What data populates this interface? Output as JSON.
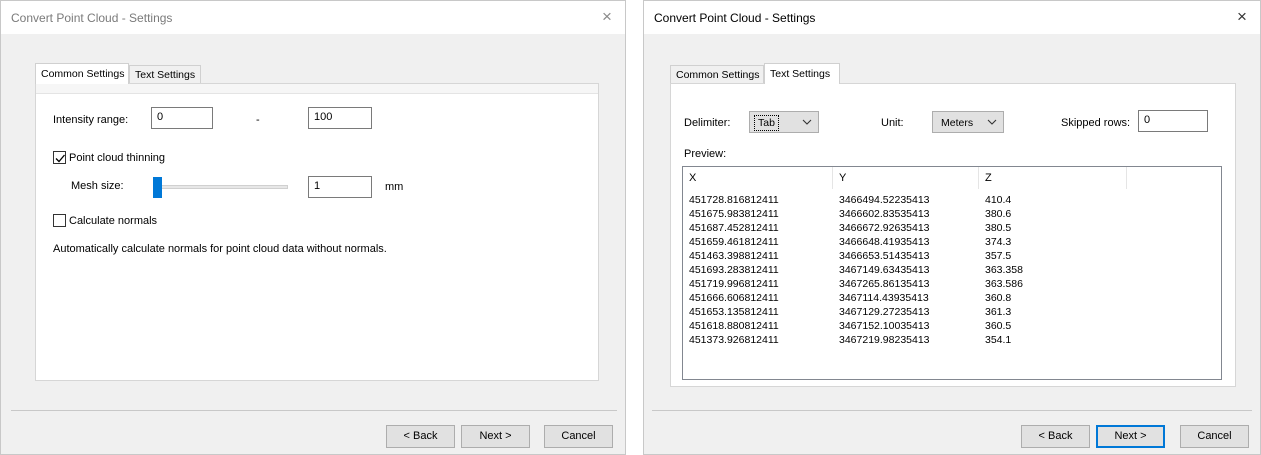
{
  "left_dialog": {
    "title": "Convert Point Cloud - Settings",
    "close_glyph": "×",
    "tabs": [
      {
        "label": "Common Settings",
        "active": true
      },
      {
        "label": "Text Settings",
        "active": false
      }
    ],
    "intensity_label": "Intensity range:",
    "intensity_min": "0",
    "intensity_dash": "-",
    "intensity_max": "100",
    "thinning_label": "Point cloud thinning",
    "thinning_checked": true,
    "mesh_label": "Mesh size:",
    "mesh_slider_value": 0,
    "mesh_value": "1",
    "mesh_unit": "mm",
    "normals_label": "Calculate normals",
    "normals_checked": false,
    "normals_description": "Automatically calculate normals for point cloud data without normals.",
    "buttons": {
      "back": "< Back",
      "next": "Next >",
      "cancel": "Cancel"
    }
  },
  "right_dialog": {
    "title": "Convert Point Cloud - Settings",
    "close_glyph": "×",
    "tabs": [
      {
        "label": "Common Settings",
        "active": false
      },
      {
        "label": "Text Settings",
        "active": true
      }
    ],
    "delimiter_label": "Delimiter:",
    "delimiter_value": "Tab",
    "unit_label": "Unit:",
    "unit_value": "Meters",
    "skipped_label": "Skipped rows:",
    "skipped_value": "0",
    "preview_label": "Preview:",
    "columns": [
      "X",
      "Y",
      "Z"
    ],
    "rows": [
      [
        "451728.816812411",
        "3466494.52235413",
        "410.4"
      ],
      [
        "451675.983812411",
        "3466602.83535413",
        "380.6"
      ],
      [
        "451687.452812411",
        "3466672.92635413",
        "380.5"
      ],
      [
        "451659.461812411",
        "3466648.41935413",
        "374.3"
      ],
      [
        "451463.398812411",
        "3466653.51435413",
        "357.5"
      ],
      [
        "451693.283812411",
        "3467149.63435413",
        "363.358"
      ],
      [
        "451719.996812411",
        "3467265.86135413",
        "363.586"
      ],
      [
        "451666.606812411",
        "3467114.43935413",
        "360.8"
      ],
      [
        "451653.135812411",
        "3467129.27235413",
        "361.3"
      ],
      [
        "451618.880812411",
        "3467152.10035413",
        "360.5"
      ],
      [
        "451373.926812411",
        "3467219.98235413",
        "354.1"
      ]
    ],
    "buttons": {
      "back": "< Back",
      "next": "Next >",
      "cancel": "Cancel"
    }
  },
  "colors": {
    "accent": "#0078d7",
    "dialog_bg": "#f0f0f0",
    "disabled_text": "#7a7a7a"
  }
}
